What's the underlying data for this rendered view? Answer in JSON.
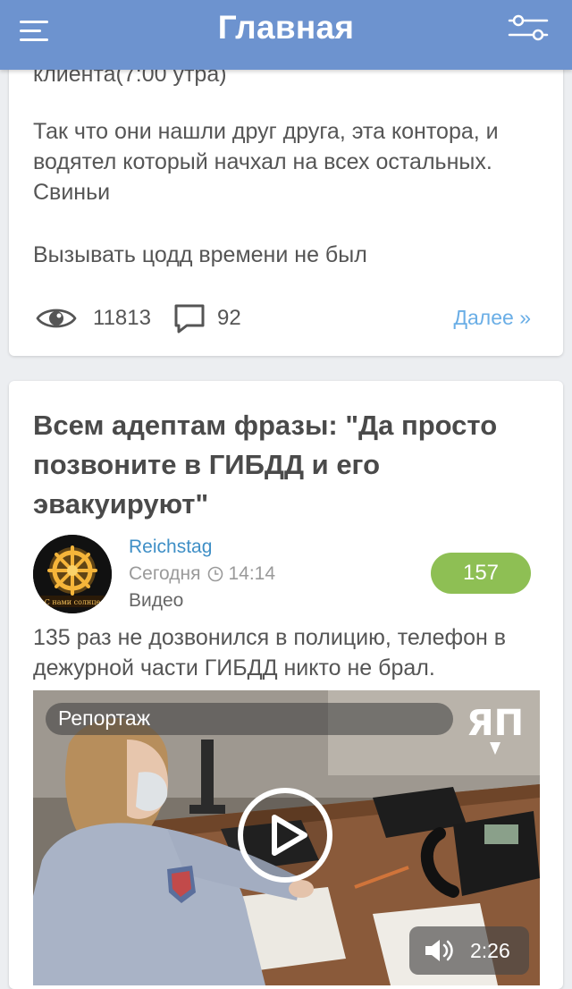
{
  "header": {
    "title": "Главная",
    "menu_icon": "hamburger-menu-icon",
    "filter_icon": "sliders-icon"
  },
  "post1": {
    "cut_text": "клиента(7:00 утра)",
    "paragraphs": [
      "Так что они нашли друг друга, эта контора, и водятел который начхал на всех остальных. Свиньи",
      "Вызывать цодд времени не был"
    ],
    "views": "11813",
    "comments": "92",
    "more_label": "Далее »"
  },
  "post2": {
    "title": "Всем адептам фразы: \"Да просто позвоните в ГИБДД и его эвакуируют\"",
    "author": "Reichstag",
    "date": "Сегодня",
    "time": "14:14",
    "category": "Видео",
    "rating": "157",
    "lead": "135 раз не дозвонился в полицию, телефон в дежурной части ГИБДД никто не брал.",
    "video": {
      "title": "Репортаж",
      "duration": "2:26",
      "logo": "ЯП"
    },
    "avatar_caption": "С нами солнце"
  },
  "colors": {
    "appbar": "#6d93cf",
    "link": "#6aaee6",
    "author": "#3f8fc6",
    "rating_badge": "#8ebf54",
    "background": "#eceef1"
  }
}
